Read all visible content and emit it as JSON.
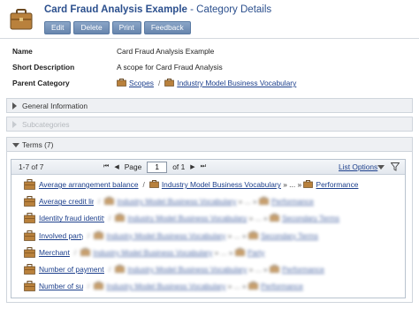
{
  "header": {
    "title": "Card Fraud Analysis Example",
    "subtitle": " - Category Details",
    "buttons": [
      "Edit",
      "Delete",
      "Print",
      "Feedback"
    ]
  },
  "properties": {
    "name_label": "Name",
    "name_value": "Card Fraud Analysis Example",
    "short_desc_label": "Short Description",
    "short_desc_value": "A scope for Card Fraud Analysis",
    "parent_label": "Parent Category",
    "parent_path": [
      "Scopes",
      "Industry Model Business Vocabulary"
    ]
  },
  "panels": {
    "general": "General Information",
    "subcategories": "Subcategories",
    "terms": "Terms (7)"
  },
  "grid": {
    "count": "1-7 of 7",
    "page_label": "Page",
    "page_value": "1",
    "of_label": "of 1",
    "list_options": "List Options",
    "rows": [
      {
        "term": "Average arrangement balance",
        "path1": "Industry Model Business Vocabulary",
        "ellipsis": "» ... »",
        "leaf": "Performance"
      },
      {
        "term": "Average credit limit",
        "path1": "Industry Model Business Vocabulary",
        "ellipsis": "» ... »",
        "leaf": "Performance"
      },
      {
        "term": "Identity fraud identity information",
        "path1": "Industry Model Business Vocabulary",
        "ellipsis": "» ... »",
        "leaf": "Secondary Terms"
      },
      {
        "term": "Involved party at transaction status",
        "path1": "Industry Model Business Vocabulary",
        "ellipsis": "» ... »",
        "leaf": "Secondary Terms"
      },
      {
        "term": "Merchant",
        "path1": "Industry Model Business Vocabulary",
        "ellipsis": "» ... »",
        "leaf": "Party"
      },
      {
        "term": "Number of payment card system",
        "path1": "Industry Model Business Vocabulary",
        "ellipsis": "» ... »",
        "leaf": "Performance"
      },
      {
        "term": "Number of suspicious transactions",
        "path1": "Industry Model Business Vocabulary",
        "ellipsis": "» ... »",
        "leaf": "Performance"
      }
    ]
  }
}
